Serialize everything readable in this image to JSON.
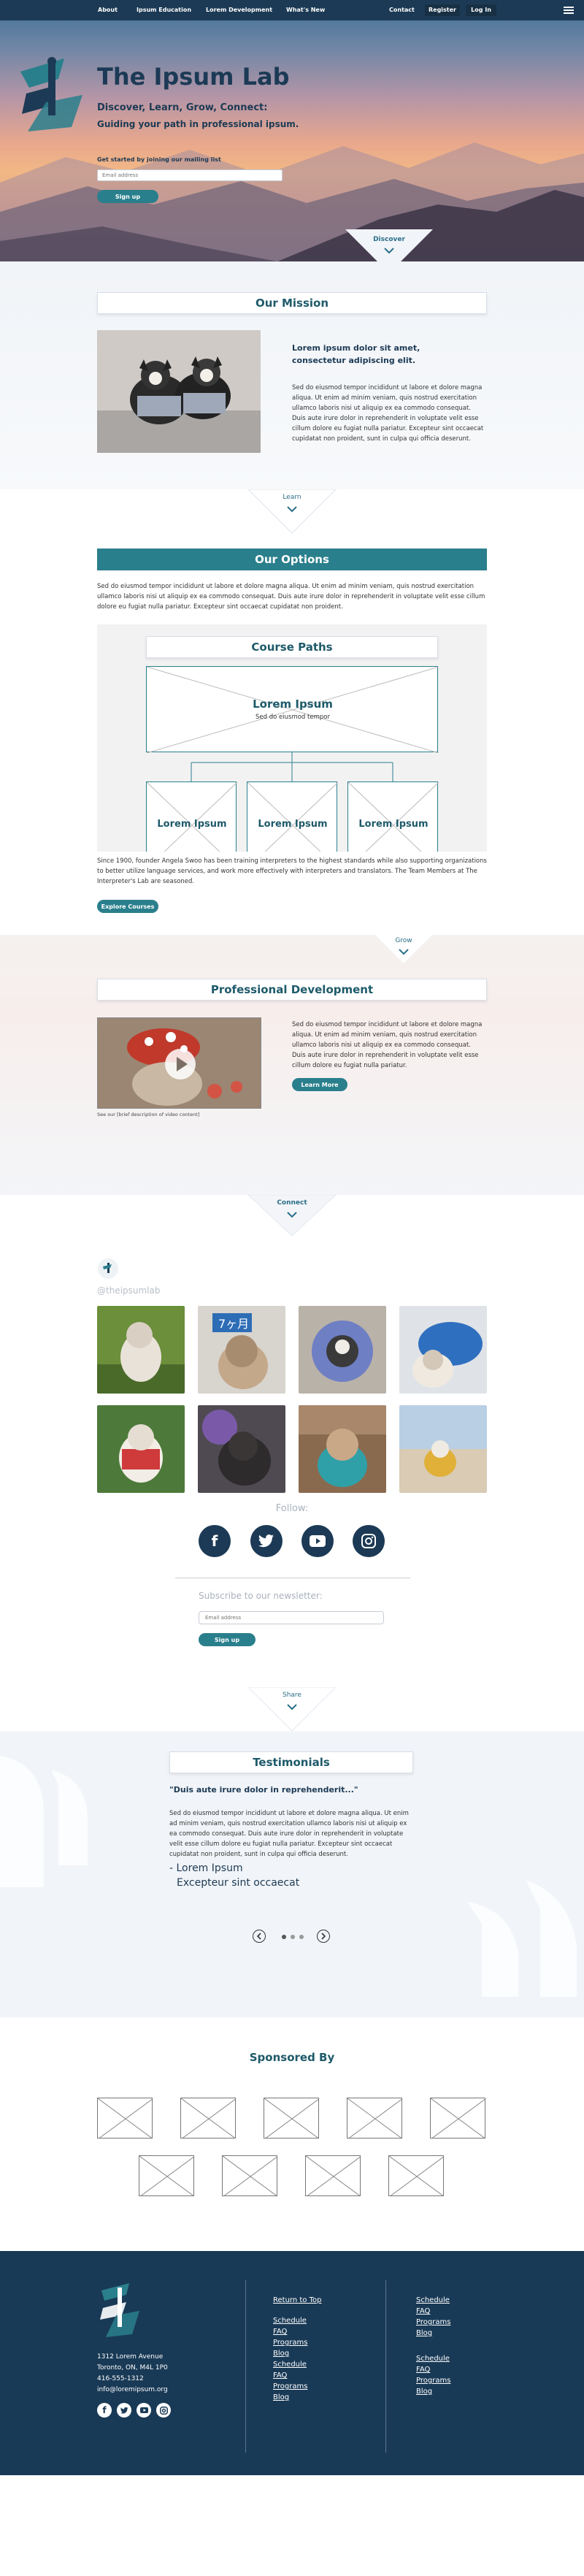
{
  "nav": {
    "links": [
      "About",
      "Ipsum Education",
      "Lorem Development",
      "What's New"
    ],
    "contact": "Contact",
    "register": "Register",
    "login": "Log In"
  },
  "hero": {
    "title": "The Ipsum Lab",
    "tagline_1": "Discover, Learn, Grow, Connect:",
    "tagline_2": "Guiding your path in professional ipsum.",
    "mailing_label": "Get started by joining our mailing list",
    "email_placeholder": "Email address",
    "signup": "Sign up",
    "discover": "Discover"
  },
  "mission": {
    "heading": "Our Mission",
    "lead": "Lorem ipsum dolor sit amet, consectetur adipiscing elit.",
    "body": "Sed do eiusmod tempor incididunt ut labore et dolore magna aliqua. Ut enim ad minim veniam, quis nostrud exercitation ullamco laboris nisi ut aliquip ex ea commodo consequat. Duis aute irure dolor in reprehenderit in voluptate velit esse cillum dolore eu fugiat nulla pariatur. Excepteur sint occaecat cupidatat non proident, sunt in culpa qui officia deserunt."
  },
  "learn": "Learn",
  "options": {
    "heading": "Our Options",
    "intro": "Sed do eiusmod tempor incididunt ut labore et dolore magna aliqua. Ut enim ad minim veniam, quis nostrud exercitation ullamco laboris nisi ut aliquip ex ea commodo consequat. Duis aute irure dolor in reprehenderit in voluptate velit esse cillum dolore eu fugiat nulla pariatur. Excepteur sint occaecat cupidatat non proident.",
    "paths_title": "Course Paths",
    "top_title": "Lorem Ipsum",
    "top_sub": "Sed do eiusmod tempor",
    "child_labels": [
      "Lorem Ipsum",
      "Lorem Ipsum",
      "Lorem Ipsum"
    ],
    "history": "Since 1900, founder Angela Swoo has been training interpreters to the highest standards while also supporting organizations to better utilize language services, and work more effectively with interpreters and translators. The Team Members at The Interpreter's Lab are seasoned.",
    "explore": "Explore Courses"
  },
  "grow": "Grow",
  "prodev": {
    "heading": "Professional Development",
    "body": "Sed do eiusmod tempor incididunt ut labore et dolore magna aliqua. Ut enim ad minim veniam, quis nostrud exercitation ullamco laboris nisi ut aliquip ex ea commodo consequat. Duis aute irure dolor in reprehenderit in voluptate velit esse cillum dolore eu fugiat nulla pariatur.",
    "learn_more": "Learn More",
    "caption": "See our [brief description of video content]"
  },
  "connect": "Connect",
  "instagram": {
    "handle": "@theipsumlab"
  },
  "follow": {
    "label": "Follow:",
    "icons": [
      "facebook-icon",
      "twitter-icon",
      "youtube-icon",
      "instagram-icon"
    ]
  },
  "newsletter": {
    "label": "Subscribe to our newsletter:",
    "placeholder": "Email address",
    "signup": "Sign up"
  },
  "share": "Share",
  "testimonials": {
    "heading": "Testimonials",
    "quote": "\"Duis aute irure dolor in reprehenderit...\"",
    "body": "Sed do eiusmod tempor incididunt ut labore et dolore magna aliqua. Ut enim ad minim veniam, quis nostrud exercitation ullamco laboris nisi ut aliquip ex ea commodo consequat. Duis aute irure dolor in reprehenderit in voluptate velit esse cillum dolore eu fugiat nulla pariatur. Excepteur sint occaecat cupidatat non proident, sunt in culpa qui officia deserunt.",
    "author": "- Lorem Ipsum",
    "author_sub": "Excepteur sint occaecat"
  },
  "sponsors": {
    "heading": "Sponsored By"
  },
  "footer": {
    "address_1": "1312 Lorem Avenue",
    "address_2": "Toronto, ON, M4L 1P0",
    "phone": "416-555-1312",
    "email": "info@loremipsum.org",
    "col1_top": "Return to Top",
    "col1": [
      "Schedule",
      "FAQ",
      "Programs",
      "Blog",
      "Schedule",
      "FAQ",
      "Programs",
      "Blog"
    ],
    "col2a": [
      "Schedule",
      "FAQ",
      "Programs",
      "Blog"
    ],
    "col2b": [
      "Schedule",
      "FAQ",
      "Programs",
      "Blog"
    ]
  },
  "colors": {
    "navy": "#1c3a55",
    "teal": "#2a7f8c",
    "heading_teal": "#1e5a6a",
    "footer_bg": "#193a56"
  }
}
